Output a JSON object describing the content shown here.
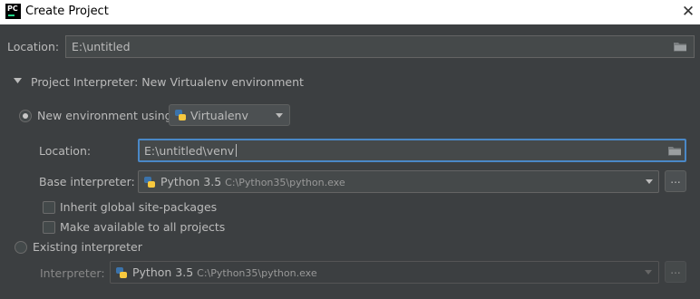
{
  "window": {
    "app_icon_text": "PC",
    "title": "Create Project",
    "close_glyph": "✕"
  },
  "location": {
    "label": "Location:",
    "value": "E:\\untitled"
  },
  "interpreter_section": {
    "header": "Project Interpreter: New Virtualenv environment",
    "new_env": {
      "label": "New environment using",
      "tool": "Virtualenv",
      "location_label": "Location:",
      "location_value": "E:\\untitled\\venv",
      "base_label": "Base interpreter:",
      "base_version": "Python 3.5",
      "base_path": "C:\\Python35\\python.exe",
      "inherit_label": "Inherit global site-packages",
      "available_label": "Make available to all projects",
      "browse_label": "..."
    },
    "existing": {
      "label": "Existing interpreter",
      "interpreter_label": "Interpreter:",
      "version": "Python 3.5",
      "path": "C:\\Python35\\python.exe",
      "browse_label": "..."
    }
  },
  "colors": {
    "background": "#3c3f41",
    "field_focus_border": "#4a88c7",
    "python_blue": "#3b73ab",
    "python_yellow": "#f7c83e"
  },
  "icons": {
    "folder": "folder-icon",
    "dropdown": "chevron-down-icon",
    "section_toggle": "triangle-down-icon",
    "python": "python-icon"
  }
}
